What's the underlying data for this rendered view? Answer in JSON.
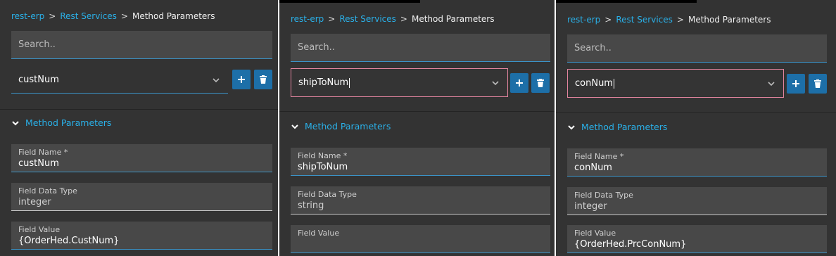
{
  "panels": [
    {
      "breadcrumb": {
        "root": "rest-erp",
        "parent": "Rest Services",
        "current": "Method Parameters",
        "separator": ">"
      },
      "search": {
        "placeholder": "Search.."
      },
      "selector": {
        "value": "custNum",
        "focused": false
      },
      "buttons": {
        "add_icon": "plus-icon",
        "delete_icon": "trash-icon"
      },
      "section": {
        "title": "Method Parameters"
      },
      "fields": {
        "name_label": "Field Name *",
        "name_value": "custNum",
        "type_label": "Field Data Type",
        "type_value": "integer",
        "value_label": "Field Value",
        "value_value": "{OrderHed.CustNum}"
      }
    },
    {
      "breadcrumb": {
        "root": "rest-erp",
        "parent": "Rest Services",
        "current": "Method Parameters",
        "separator": ">"
      },
      "search": {
        "placeholder": "Search.."
      },
      "selector": {
        "value": "shipToNum",
        "focused": true
      },
      "buttons": {
        "add_icon": "plus-icon",
        "delete_icon": "trash-icon"
      },
      "section": {
        "title": "Method Parameters"
      },
      "fields": {
        "name_label": "Field Name *",
        "name_value": "shipToNum",
        "type_label": "Field Data Type",
        "type_value": "string",
        "value_label": "Field Value",
        "value_value": ""
      }
    },
    {
      "breadcrumb": {
        "root": "rest-erp",
        "parent": "Rest Services",
        "current": "Method Parameters",
        "separator": ">"
      },
      "search": {
        "placeholder": "Search.."
      },
      "selector": {
        "value": "conNum",
        "focused": true
      },
      "buttons": {
        "add_icon": "plus-icon",
        "delete_icon": "trash-icon"
      },
      "section": {
        "title": "Method Parameters"
      },
      "fields": {
        "name_label": "Field Name *",
        "name_value": "conNum",
        "type_label": "Field Data Type",
        "type_value": "integer",
        "value_label": "Field Value",
        "value_value": "{OrderHed.PrcConNum}"
      }
    }
  ],
  "colors": {
    "panel_bg": "#333333",
    "field_bg": "#484848",
    "accent_link": "#2ab0e8",
    "button_bg": "#1d6fa8",
    "focus_border": "#e2849e",
    "underline": "#3b93c7"
  }
}
